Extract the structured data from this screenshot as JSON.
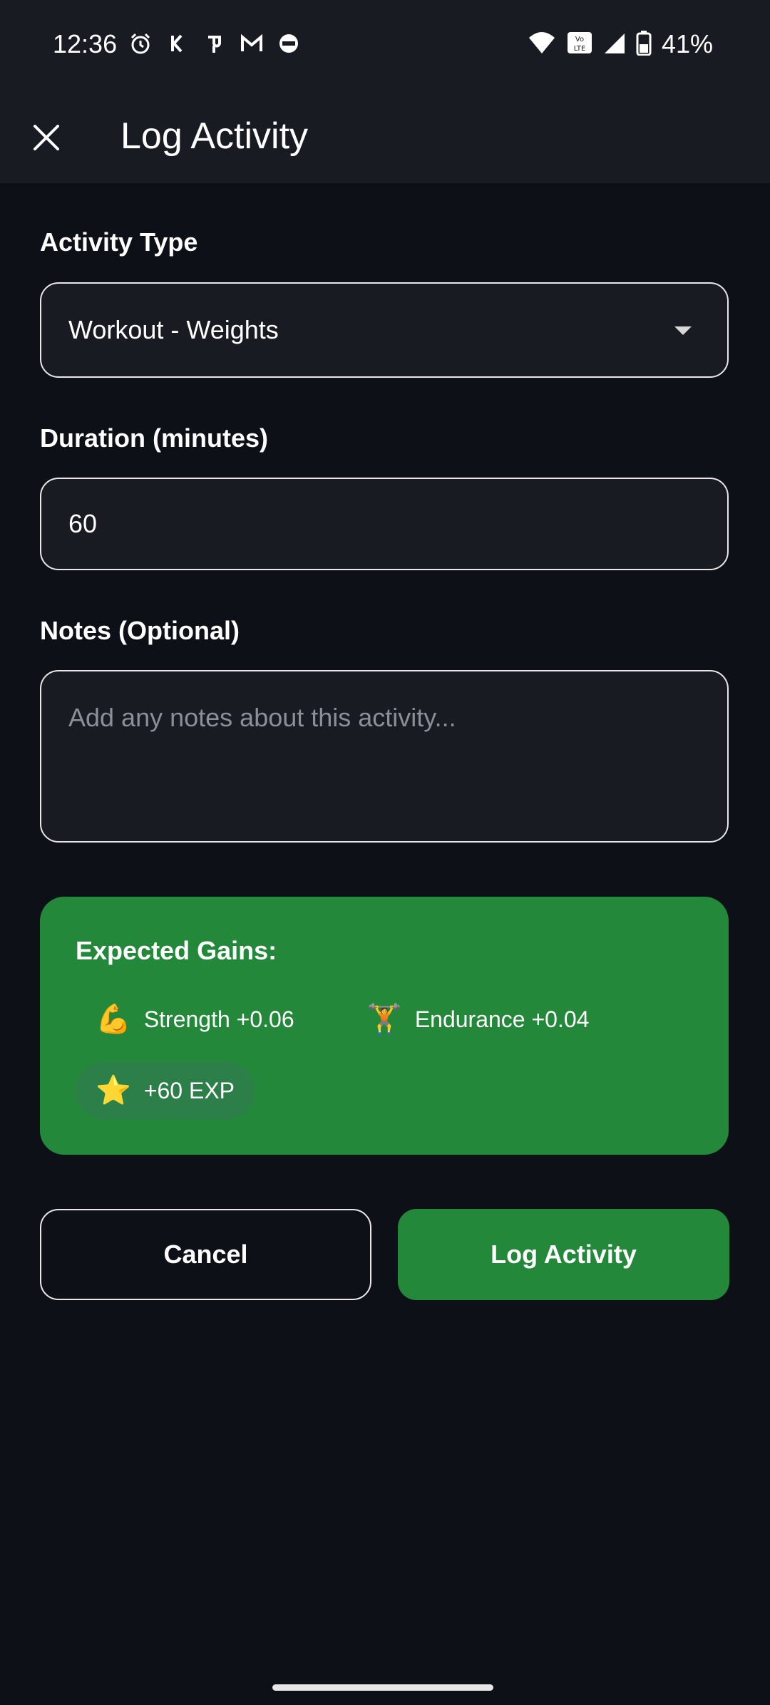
{
  "status_bar": {
    "time": "12:36",
    "battery": "41%",
    "left_icons": [
      "alarm-icon",
      "app-icon-k",
      "app-icon-pe",
      "gmail-icon",
      "notification-icon"
    ],
    "right_icons": [
      "wifi-icon",
      "volte-icon",
      "signal-icon",
      "battery-icon"
    ]
  },
  "app_bar": {
    "title": "Log Activity",
    "close_icon": "close-icon"
  },
  "form": {
    "activity_type": {
      "label": "Activity Type",
      "value": "Workout - Weights"
    },
    "duration": {
      "label": "Duration (minutes)",
      "value": "60"
    },
    "notes": {
      "label": "Notes (Optional)",
      "value": "",
      "placeholder": "Add any notes about this activity..."
    }
  },
  "gains": {
    "title": "Expected Gains:",
    "items": [
      {
        "icon": "💪",
        "label": "Strength +0.06"
      },
      {
        "icon": "🏋",
        "label": "Endurance +0.04"
      },
      {
        "icon": "⭐",
        "label": "+60 EXP"
      }
    ]
  },
  "actions": {
    "cancel_label": "Cancel",
    "submit_label": "Log Activity"
  },
  "colors": {
    "background": "#0d1017",
    "surface": "#181b22",
    "accent_green": "#23883a",
    "chip_green": "#2c7f49",
    "placeholder": "#8b8f98"
  }
}
